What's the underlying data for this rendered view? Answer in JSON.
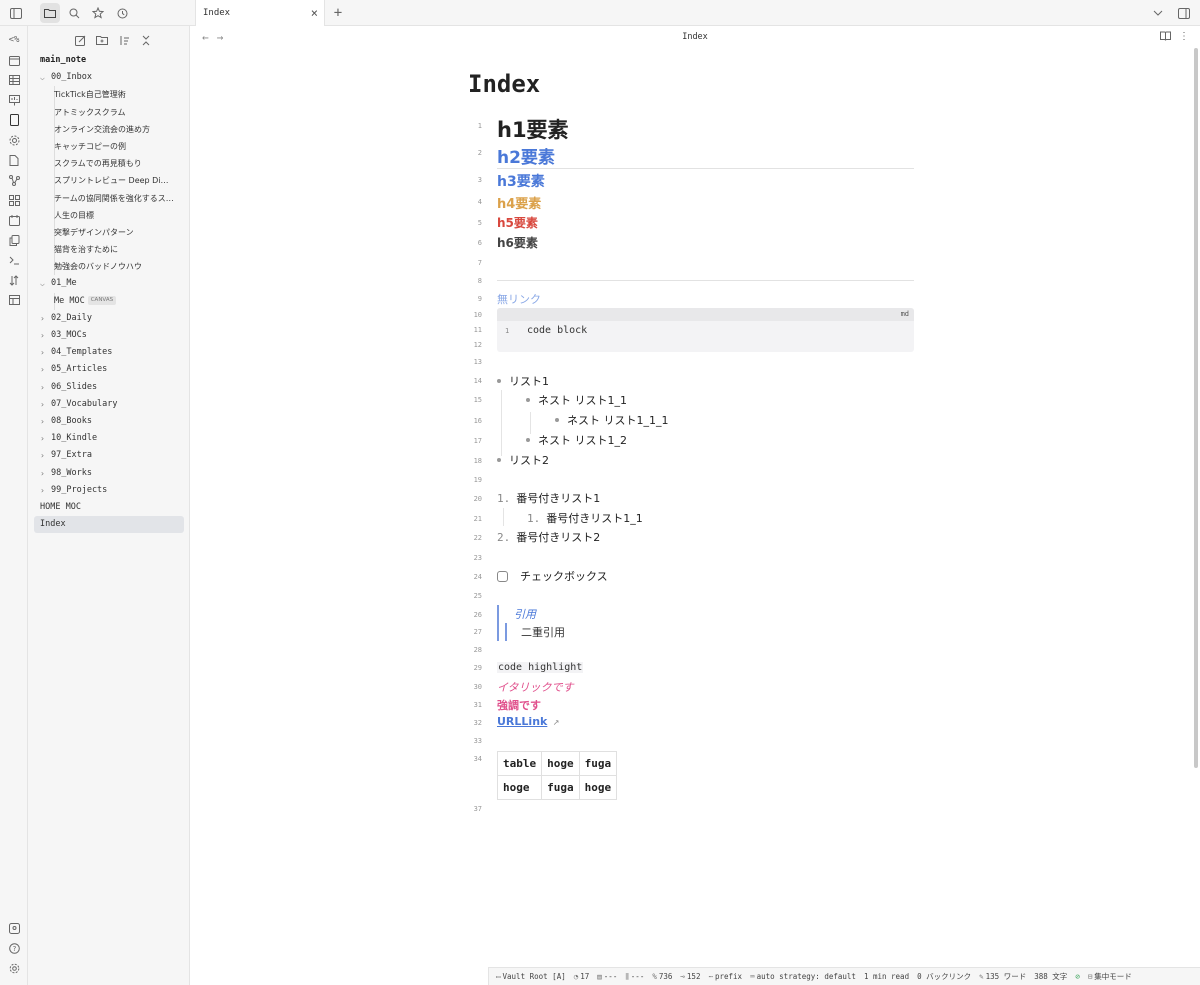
{
  "tab": {
    "title": "Index",
    "close": "×",
    "new": "+"
  },
  "topbar": {
    "left_icons": [
      "sidebar-toggle-icon",
      "files-icon",
      "search-icon",
      "bookmark-star-icon",
      "recent-clock-icon"
    ],
    "right_icons": [
      "chevron-down-icon",
      "right-sidebar-icon"
    ]
  },
  "ribbon": {
    "top_label": "<%",
    "icons": [
      "calendar-icon",
      "table-icon",
      "presentation-icon",
      "phone-icon",
      "gear-outline-icon",
      "file-sync-icon",
      "graph-icon",
      "dashboard-icon",
      "calendar-grid-icon",
      "copy-icon",
      "terminal-icon",
      "sort-icon",
      "layout-icon"
    ],
    "bottom_icons": [
      "vault-icon",
      "help-icon",
      "settings-icon"
    ]
  },
  "sidebar": {
    "actions": [
      "new-note-icon",
      "new-folder-icon",
      "sort-order-icon",
      "collapse-all-icon"
    ],
    "vault_name": "main_note",
    "inbox": {
      "name": "00_Inbox",
      "items": [
        "TickTick自己管理術",
        "アトミックスクラム",
        "オンライン交流会の進め方",
        "キャッチコピーの例",
        "スクラムでの再見積もり",
        "スプリントレビュー Deep Di…",
        "チームの協同関係を強化するス…",
        "人生の目標",
        "突撃デザインパターン",
        "猫背を治すために",
        "勉強会のバッドノウハウ"
      ]
    },
    "me": {
      "name": "01_Me",
      "items": [
        {
          "label": "Me MOC",
          "badge": "CANVAS"
        }
      ]
    },
    "folders": [
      "02_Daily",
      "03_MOCs",
      "04_Templates",
      "05_Articles",
      "06_Slides",
      "07_Vocabulary",
      "08_Books",
      "10_Kindle",
      "97_Extra",
      "98_Works",
      "99_Projects"
    ],
    "root_files": [
      "HOME MOC",
      "Index"
    ],
    "active_file": "Index"
  },
  "view": {
    "title": "Index",
    "back": "←",
    "forward": "→"
  },
  "doc": {
    "title": "Index",
    "line_numbers": [
      "1",
      "2",
      "3",
      "4",
      "5",
      "6",
      "7",
      "8",
      "9",
      "10",
      "11",
      "12",
      "13",
      "14",
      "15",
      "16",
      "17",
      "18",
      "19",
      "20",
      "21",
      "22",
      "23",
      "24",
      "25",
      "26",
      "27",
      "28",
      "29",
      "30",
      "31",
      "32",
      "33",
      "34",
      "37"
    ],
    "h1": "h1要素",
    "h2": "h2要素",
    "h3": "h3要素",
    "h4": "h4要素",
    "h5": "h5要素",
    "h6": "h6要素",
    "broken_link": "無リンク",
    "code_lang": "md",
    "code_line_num": "1",
    "code_text": "code block",
    "list": [
      "リスト1",
      "ネスト リスト1_1",
      "ネスト リスト1_1_1",
      "ネスト リスト1_2",
      "リスト2"
    ],
    "ordered": [
      {
        "num": "1.",
        "text": "番号付きリスト1"
      },
      {
        "num": "1.",
        "text": "番号付きリスト1_1"
      },
      {
        "num": "2.",
        "text": "番号付きリスト2"
      }
    ],
    "checkbox_label": "チェックボックス",
    "quote": "引用",
    "nested_quote": "二重引用",
    "inline_code": "code highlight",
    "italic": "イタリックです",
    "bold": "強調です",
    "url_link": "URLLink",
    "url_link_icon": "↗",
    "table": [
      [
        "table",
        "hoge",
        "fuga"
      ],
      [
        "hoge",
        "fuga",
        "hoge"
      ]
    ]
  },
  "statusbar": {
    "vault": "Vault Root [A]",
    "a": "17",
    "b": "---",
    "c": "---",
    "d": "736",
    "e": "152",
    "prefix": "prefix",
    "auto": "auto strategy: default",
    "read": "1 min read",
    "backlinks": "0 バックリンク",
    "words": "135 ワード",
    "chars": "388 文字",
    "focus": "集中モード"
  }
}
